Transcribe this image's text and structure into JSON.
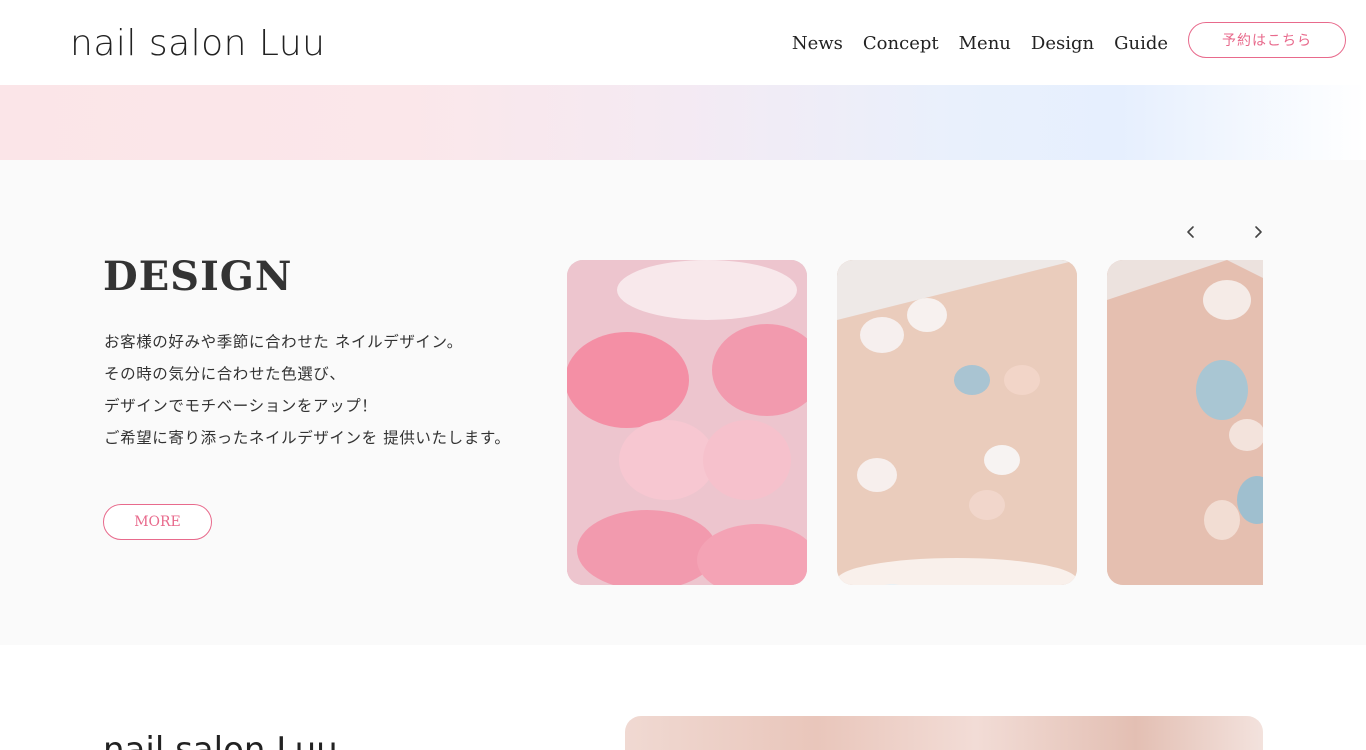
{
  "header": {
    "logo": "nail salon Luu",
    "nav": [
      "News",
      "Concept",
      "Menu",
      "Design",
      "Guide"
    ],
    "reserve_label": "予約はこちら"
  },
  "design": {
    "title": "DESIGN",
    "lines": [
      "お客様の好みや季節に合わせた ネイルデザイン。",
      "その時の気分に合わせた色選び、",
      "デザインでモチベーションをアップ！",
      "ご希望に寄り添ったネイルデザインを 提供いたします。"
    ],
    "more_label": "MORE",
    "gallery": [
      "pink-cherry-blossom-nails",
      "pastel-blue-nude-nails",
      "blue-floral-nude-nails"
    ]
  },
  "lower": {
    "title": "nail salon Luu"
  },
  "colors": {
    "accent": "#e86a8c",
    "section_bg": "#fafafa",
    "band_pink": "#fbe5e8",
    "band_blue": "#e6effe"
  }
}
